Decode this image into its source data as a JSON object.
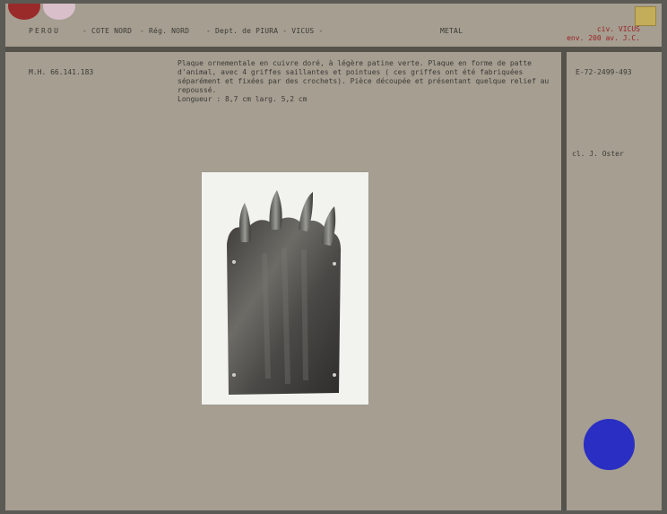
{
  "header": {
    "country": "PEROU",
    "region": "- COTE NORD",
    "reg": "- Rég. NORD",
    "dept": "- Dept. de PIURA - VICUS -",
    "material": "METAL",
    "civilization": "civ. VICUS",
    "date": "env. 200 av. J.C."
  },
  "inventory_number": "M.H. 66.141.183",
  "description": {
    "text": "Plaque ornementale en cuivre doré, à légère patine verte. Plaque en forme de patte d'animal, avec 4 griffes saillantes et pointues ( ces griffes ont été fabriquées séparément et fixées par des crochets). Pièce découpée et présentant quelque relief au repoussé.",
    "dimensions": "Longueur : 8,7 cm  larg. 5,2 cm"
  },
  "negative_number": "E-72-2499-493",
  "photographer": "cl. J. Oster",
  "colors": {
    "card": "#a59e91",
    "red_text": "#9a2323",
    "blue_dot": "#2a2ec2",
    "red_dot": "#9a2a2a",
    "pink_dot": "#d8bfc9",
    "gold_square": "#c3ad5a"
  }
}
